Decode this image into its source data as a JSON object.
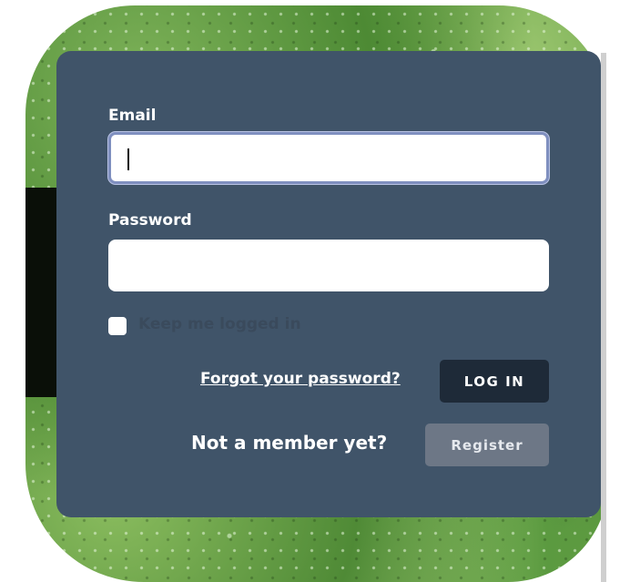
{
  "form": {
    "email_label": "Email",
    "email_value": "",
    "password_label": "Password",
    "password_value": "",
    "keep_logged_in_label": "Keep me logged in",
    "keep_logged_in_checked": false,
    "forgot_password_label": "Forgot your password?",
    "login_button_label": "LOG IN",
    "not_member_text": "Not a member yet?",
    "register_button_label": "Register"
  },
  "colors": {
    "panel": "#405469",
    "login_button": "#1e2a38",
    "register_button": "#6d7786",
    "focus_ring": "#7f8fbf"
  }
}
